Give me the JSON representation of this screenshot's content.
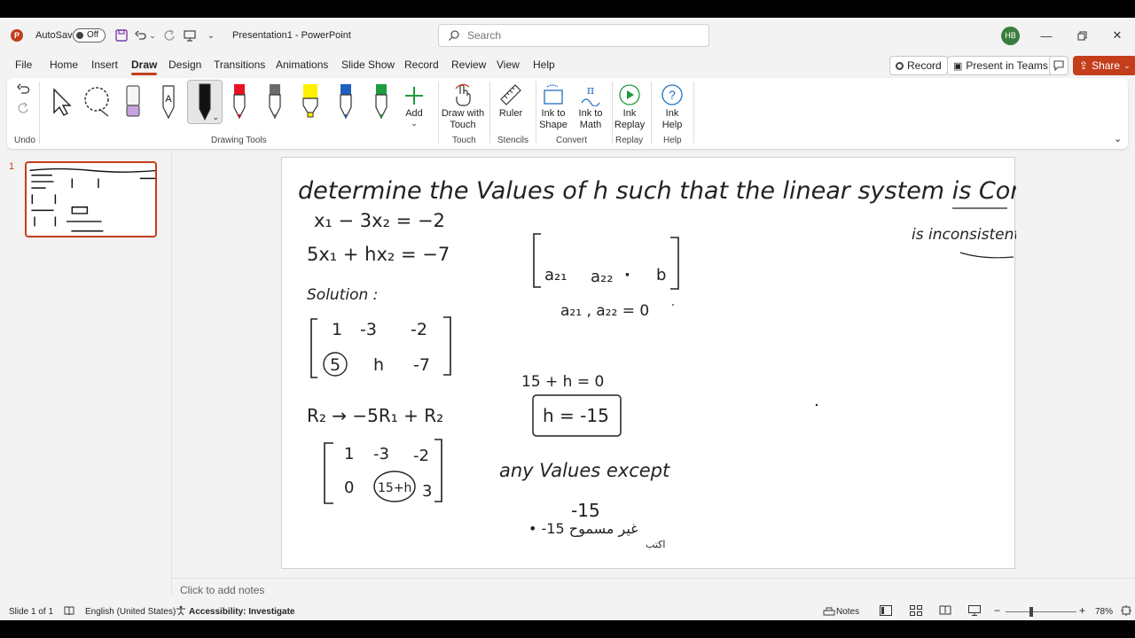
{
  "titlebar": {
    "autosave_label": "AutoSave",
    "autosave_state": "Off",
    "doc_title": "Presentation1  -  PowerPoint",
    "search_placeholder": "Search",
    "user_initials": "HB"
  },
  "menu": {
    "tabs": [
      "File",
      "Home",
      "Insert",
      "Draw",
      "Design",
      "Transitions",
      "Animations",
      "Slide Show",
      "Record",
      "Review",
      "View",
      "Help"
    ],
    "active_tab": "Draw",
    "record_label": "Record",
    "present_label": "Present in Teams",
    "share_label": "Share"
  },
  "ribbon": {
    "groups": {
      "undo": "Undo",
      "drawing_tools": "Drawing Tools",
      "touch": "Touch",
      "stencils": "Stencils",
      "convert": "Convert",
      "replay": "Replay",
      "help": "Help"
    },
    "buttons": {
      "add": "Add",
      "draw_with_touch_1": "Draw with",
      "draw_with_touch_2": "Touch",
      "ruler": "Ruler",
      "ink_to_shape_1": "Ink to",
      "ink_to_shape_2": "Shape",
      "ink_to_math_1": "Ink to",
      "ink_to_math_2": "Math",
      "ink_replay_1": "Ink",
      "ink_replay_2": "Replay",
      "ink_help_1": "Ink",
      "ink_help_2": "Help"
    },
    "pen_colors": [
      "#111111",
      "#e81123",
      "#6b6b6b",
      "#fff100",
      "#1f5fbf",
      "#1c9c3c"
    ]
  },
  "thumbnails": {
    "slide_number": "1"
  },
  "slide": {
    "line1": "determine the Values of h such that the linear system is Consistent",
    "side_note": "is inconsistent",
    "eq1": "x₁ − 3x₂ = −2",
    "eq2": "5x₁ + hx₂ = −7",
    "solution": "Solution :",
    "m1_r1": [
      "1",
      "-3",
      "-2"
    ],
    "m1_r2": [
      "5",
      "h",
      "-7"
    ],
    "op": "R₂ → −5R₁ + R₂",
    "m2_r1": [
      "1",
      "-3",
      "-2"
    ],
    "m2_r2": [
      "0",
      "15+h",
      "3"
    ],
    "gen_row": [
      "a₂₁",
      "a₂₂",
      "·",
      "b"
    ],
    "gen_cond": "a₂₁ , a₂₂ = 0",
    "cond": "15 + h = 0",
    "answer": "h = -15",
    "any_values": "any Values except",
    "minus15": "-15",
    "arabic_note": "• -15 غير مسموح",
    "arabic_sub": "اكتب"
  },
  "notes": {
    "placeholder": "Click to add notes"
  },
  "status": {
    "slide_of": "Slide 1 of 1",
    "language": "English (United States)",
    "accessibility": "Accessibility: Investigate",
    "notes_label": "Notes",
    "zoom": "78%"
  }
}
